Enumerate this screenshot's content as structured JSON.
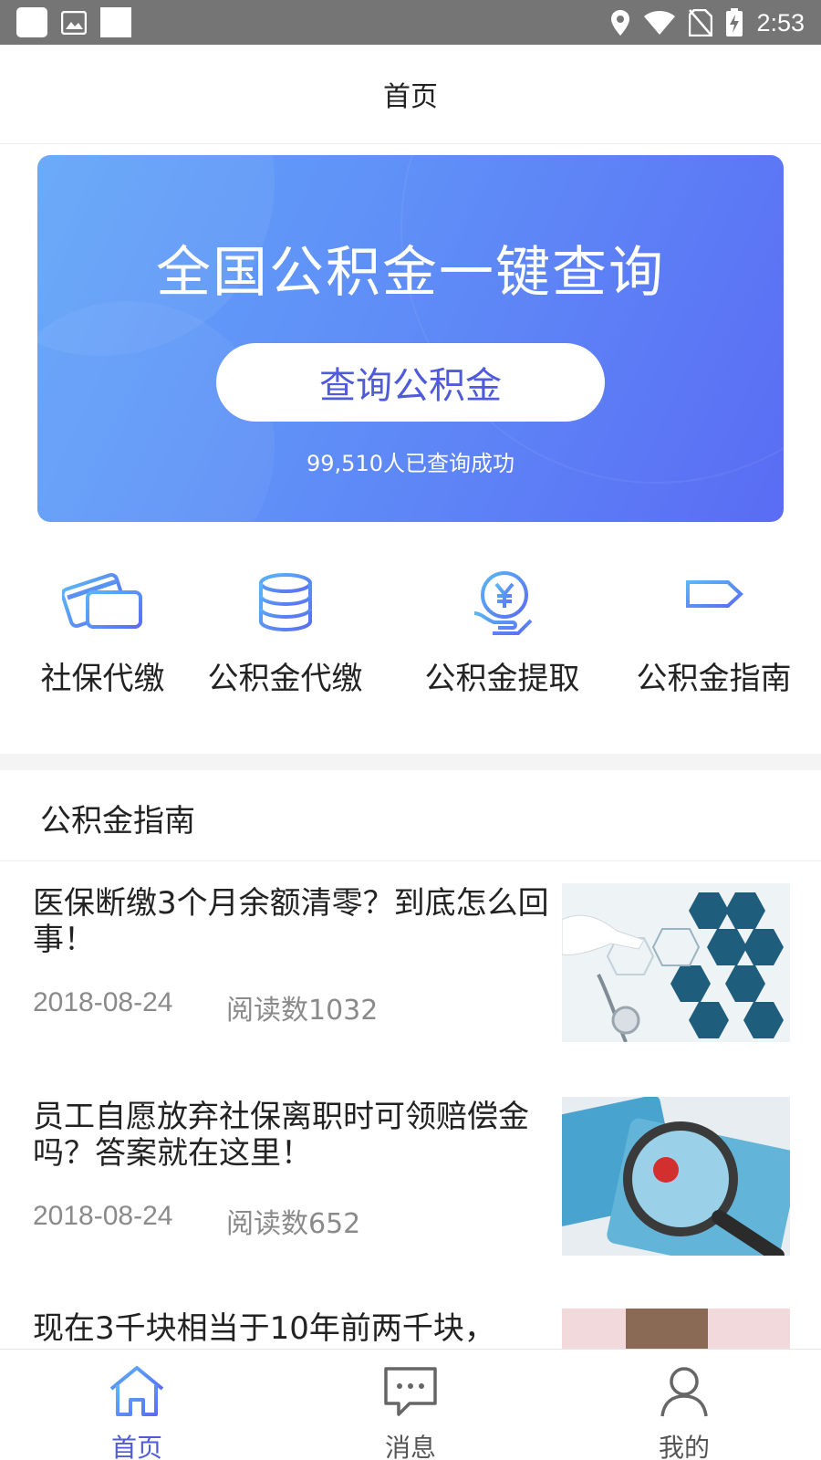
{
  "status_bar": {
    "time": "2:53"
  },
  "header": {
    "title": "首页"
  },
  "banner": {
    "title": "全国公积金一键查询",
    "button_label": "查询公积金",
    "count_text": "99,510人已查询成功"
  },
  "quick_actions": [
    {
      "label": "社保代缴",
      "icon": "card-icon"
    },
    {
      "label": "公积金代缴",
      "icon": "database-icon"
    },
    {
      "label": "公积金提取",
      "icon": "yuan-hand-icon"
    },
    {
      "label": "公积金指南",
      "icon": "signpost-icon"
    }
  ],
  "guide_section": {
    "title": "公积金指南"
  },
  "articles": [
    {
      "title": "医保断缴3个月余额清零？到底怎么回事！",
      "date": "2018-08-24",
      "reads": "阅读数1032"
    },
    {
      "title": "员工自愿放弃社保离职时可领赔偿金吗？答案就在这里！",
      "date": "2018-08-24",
      "reads": "阅读数652"
    },
    {
      "title": "现在3千块相当于10年前两千块，",
      "date": "",
      "reads": ""
    }
  ],
  "bottom_nav": [
    {
      "label": "首页",
      "icon": "home-icon",
      "active": true
    },
    {
      "label": "消息",
      "icon": "message-icon",
      "active": false
    },
    {
      "label": "我的",
      "icon": "user-icon",
      "active": false
    }
  ],
  "colors": {
    "accent": "#4f5bd8",
    "banner_start": "#62a6f8",
    "banner_end": "#5a6cf4"
  }
}
